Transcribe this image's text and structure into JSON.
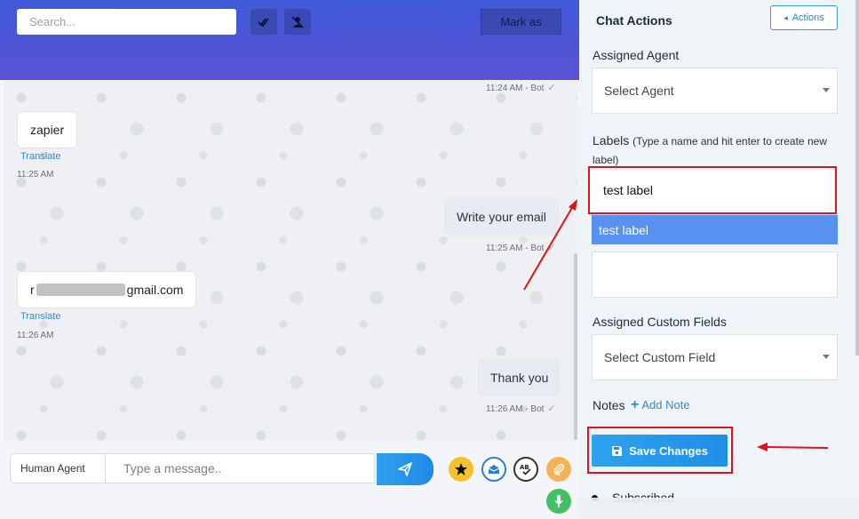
{
  "header": {
    "search_placeholder": "Search...",
    "mark_as_label": "Mark as",
    "icons": [
      "double-check-icon",
      "user-slash-icon"
    ]
  },
  "messages": [
    {
      "direction": "out",
      "time": "11:24 AM - Bot"
    },
    {
      "direction": "in",
      "text": "zapier",
      "translate": "Translate",
      "time": "11:25 AM"
    },
    {
      "direction": "out",
      "text": "Write your email",
      "time": "11:25 AM - Bot"
    },
    {
      "direction": "in",
      "text_prefix": "r",
      "text_suffix": "gmail.com",
      "translate": "Translate",
      "time": "11:26 AM"
    },
    {
      "direction": "out",
      "text": "Thank you",
      "time": "11:26 AM - Bot"
    }
  ],
  "composer": {
    "agent_type": "Human Agent",
    "message_placeholder": "Type a message..",
    "icons": [
      "send-icon",
      "star-icon",
      "mail-icon",
      "spellcheck-icon",
      "attachment-icon",
      "microphone-icon"
    ]
  },
  "panel": {
    "title": "Chat Actions",
    "actions_button": "Actions",
    "assigned_agent_label": "Assigned Agent",
    "assigned_agent_value": "Select Agent",
    "labels_label": "Labels",
    "labels_hint": "(Type a name and hit enter to create new label)",
    "labels_input_value": "test label",
    "labels_suggestion": "test label",
    "custom_fields_label": "Assigned Custom Fields",
    "custom_fields_value": "Select Custom Field",
    "notes_label": "Notes",
    "add_note": "Add Note",
    "save_button": "Save Changes",
    "subscribed_text": "Subscribed"
  },
  "colors": {
    "header_gradient": [
      "#3f5ad8",
      "#5a52d6"
    ],
    "accent_blue": "#1f8fe6",
    "annotation_red": "#e0131d",
    "suggestion_blue": "#5792f0"
  }
}
